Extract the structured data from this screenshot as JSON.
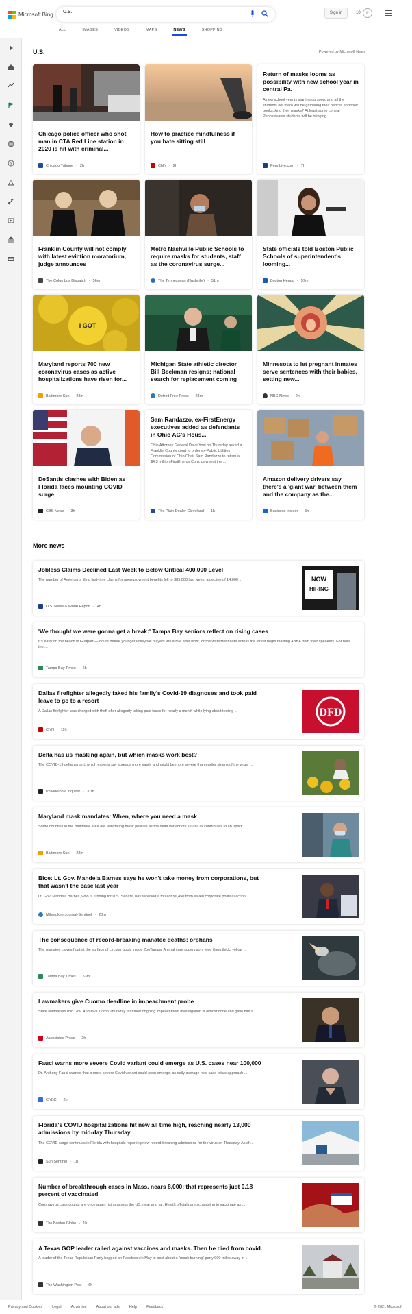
{
  "header": {
    "brand": "Microsoft Bing",
    "search_value": "U.S.",
    "signin_label": "Sign in",
    "rewards_count": "10",
    "logo_colors": [
      "#f25022",
      "#7fba00",
      "#00a4ef",
      "#ffb900"
    ]
  },
  "tabs": [
    "ALL",
    "IMAGES",
    "VIDEOS",
    "MAPS",
    "NEWS",
    "SHOPPING"
  ],
  "active_tab": "NEWS",
  "sidebar_icons": [
    "expand-icon",
    "home-icon",
    "trending-icon",
    "flag-icon",
    "location-icon",
    "globe-icon",
    "money-icon",
    "science-icon",
    "rocket-icon",
    "entertainment-icon",
    "government-icon",
    "card-icon"
  ],
  "section": {
    "title": "U.S.",
    "powered": "Powered by Microsoft News"
  },
  "cards": [
    {
      "title": "Chicago police officer who shot man in CTA Red Line station in 2020 is hit with criminal...",
      "source": "Chicago Tribune",
      "time": "2h",
      "src_color": "#1f4e9a"
    },
    {
      "title": "How to practice mindfulness if you hate sitting still",
      "source": "CNN",
      "time": "2h",
      "src_color": "#cc0000"
    },
    {
      "title": "Return of masks looms as possibility with new school year in central Pa.",
      "snippet": "A new school year is starting up soon, and all the students out there will be gathering their pencils and their books. And their masks? At least some central Pennsylvania students will be bringing ...",
      "source": "PennLive.com",
      "time": "7h",
      "src_color": "#1a3d7c"
    },
    {
      "title": "Franklin County will not comply with latest eviction moratorium, judge announces",
      "source": "The Columbus Dispatch",
      "time": "56m",
      "src_color": "#444444"
    },
    {
      "title": "Metro Nashville Public Schools to require masks for students, staff as the coronavirus surge...",
      "source": "The Tennessean (Nashville)",
      "time": "51m",
      "src_color": "#2a6fb0"
    },
    {
      "title": "State officials told Boston Public Schools of superintendent's looming...",
      "source": "Boston Herald",
      "time": "57m",
      "src_color": "#1c5bb5"
    },
    {
      "title": "Maryland reports 700 new coronavirus cases as active hospitalizations have risen for...",
      "source": "Baltimore Sun",
      "time": "23m",
      "src_color": "#f0a000"
    },
    {
      "title": "Michigan State athletic director Bill Beekman resigns; national search for replacement coming",
      "source": "Detroit Free Press",
      "time": "23m",
      "src_color": "#2a7ac0"
    },
    {
      "title": "Minnesota to let pregnant inmates serve sentences with their babies, setting new...",
      "source": "NBC News",
      "time": "2h",
      "src_color": "#333333"
    },
    {
      "title": "DeSantis clashes with Biden as Florida faces mounting COVID surge",
      "source": "CBS News",
      "time": "3h",
      "src_color": "#222222"
    },
    {
      "title": "Sam Randazzo, ex-FirstEnergy executives added as defendants in Ohio AG's Hous...",
      "snippet": "Ohio Attorney General Dave Yost on Thursday asked a Franklin County court to order ex-Public Utilities Commission of Ohio Chair Sam Randazzo to return a $4.3 million FirstEnergy Corp. payment the ...",
      "source": "The Plain Dealer Cleveland",
      "time": "1h",
      "src_color": "#1d4f91"
    },
    {
      "title": "Amazon delivery drivers say there's a 'giant war' between them and the company as the...",
      "source": "Business Insider",
      "time": "5h",
      "src_color": "#1565d8"
    }
  ],
  "more_news": {
    "title": "More news",
    "items": [
      {
        "title": "Jobless Claims Declined Last Week to Below Critical 400,000 Level",
        "snippet": "The number of Americans filing first-time claims for unemployment benefits fell to 385,000 last week, a decline of 14,000 ...",
        "source": "U.S. News & World Report",
        "time": "4h",
        "src_color": "#1b3f8b"
      },
      {
        "title": "'We thought we were gonna get a break:' Tampa Bay seniors reflect on rising cases",
        "snippet": "It's early on the beach in Gulfport — hours before younger volleyball players will arrive after work, or the waterfront bars across the street begin blasting ABBA from their speakers. For now, the ...",
        "source": "Tampa Bay Times",
        "time": "6h",
        "src_color": "#2b8a5a"
      },
      {
        "title": "Dallas firefighter allegedly faked his family's Covid-19 diagnoses and took paid leave to go to a resort",
        "snippet": "A Dallas firefighter was charged with theft after allegedly taking paid leave for nearly a month while lying about testing ...",
        "source": "CNN",
        "time": "11h",
        "src_color": "#cc0000"
      },
      {
        "title": "Delta has us masking again, but which masks work best?",
        "snippet": "The COVID-19 delta variant, which experts say spreads more easily and might be more severe than earlier strains of the virus, ...",
        "source": "Philadelphia Inquirer",
        "time": "37m",
        "src_color": "#222222"
      },
      {
        "title": "Maryland mask mandates: When, where you need a mask",
        "snippet": "Some counties in the Baltimore area are reinstating mask policies as the delta variant of COVID-19 contributes to an uptick ...",
        "source": "Baltimore Sun",
        "time": "23m",
        "src_color": "#f0a000"
      },
      {
        "title": "Bice: Lt. Gov. Mandela Barnes says he won't take money from corporations, but that wasn't the case last year",
        "snippet": "Lt. Gov. Mandela Barnes, who is running for U.S. Senate, has received a total of $6,450 from seven corporate political action ...",
        "source": "Milwaukee Journal-Sentinel",
        "time": "20m",
        "src_color": "#2a7ac0"
      },
      {
        "title": "The consequence of record-breaking manatee deaths: orphans",
        "snippet": "The manatee calves float at the surface of circular pools inside ZooTampa. Animal care supervisors feed them thick, yellow ...",
        "source": "Tampa Bay Times",
        "time": "53m",
        "src_color": "#2b8a5a"
      },
      {
        "title": "Lawmakers give Cuomo deadline in impeachment probe",
        "snippet": "State lawmakers told Gov. Andrew Cuomo Thursday that their ongoing impeachment investigation is almost done and gave him a ...",
        "source": "Associated Press",
        "time": "2h",
        "src_color": "#d0021b"
      },
      {
        "title": "Fauci warns more severe Covid variant could emerge as U.S. cases near 100,000",
        "snippet": "Dr. Anthony Fauci warned that a more severe Covid variant could soon emerge, as daily average new case totals approach ...",
        "source": "CNBC",
        "time": "2h",
        "src_color": "#3a6bd8"
      },
      {
        "title": "Florida's COVID hospitalizations hit new all time high, reaching nearly 13,000 admissions by mid-day Thursday",
        "snippet": "The COVID surge continues in Florida with hospitals reporting new record-breaking admissions for the virus on Thursday. As of ...",
        "source": "Sun Sentinel",
        "time": "1h",
        "src_color": "#222222"
      },
      {
        "title": "Number of breakthrough cases in Mass. nears 8,000; that represents just 0.18 percent of vaccinated",
        "snippet": "Coronavirus case counts are once again rising across the US, near and far. Health officials are scrambling to vaccinate as ...",
        "source": "The Boston Globe",
        "time": "1h",
        "src_color": "#333333"
      },
      {
        "title": "A Texas GOP leader railed against vaccines and masks. Then he died from covid.",
        "snippet": "A leader of the Texas Republican Party hopped on Facebook in May to post about a \"mask burning\" party 900 miles away in ...",
        "source": "The Washington Post",
        "time": "6h",
        "src_color": "#333333"
      }
    ]
  },
  "footer": {
    "links": [
      "Privacy and Cookies",
      "Legal",
      "Advertise",
      "About our ads",
      "Help",
      "Feedback"
    ],
    "copyright": "© 2021 Microsoft"
  }
}
